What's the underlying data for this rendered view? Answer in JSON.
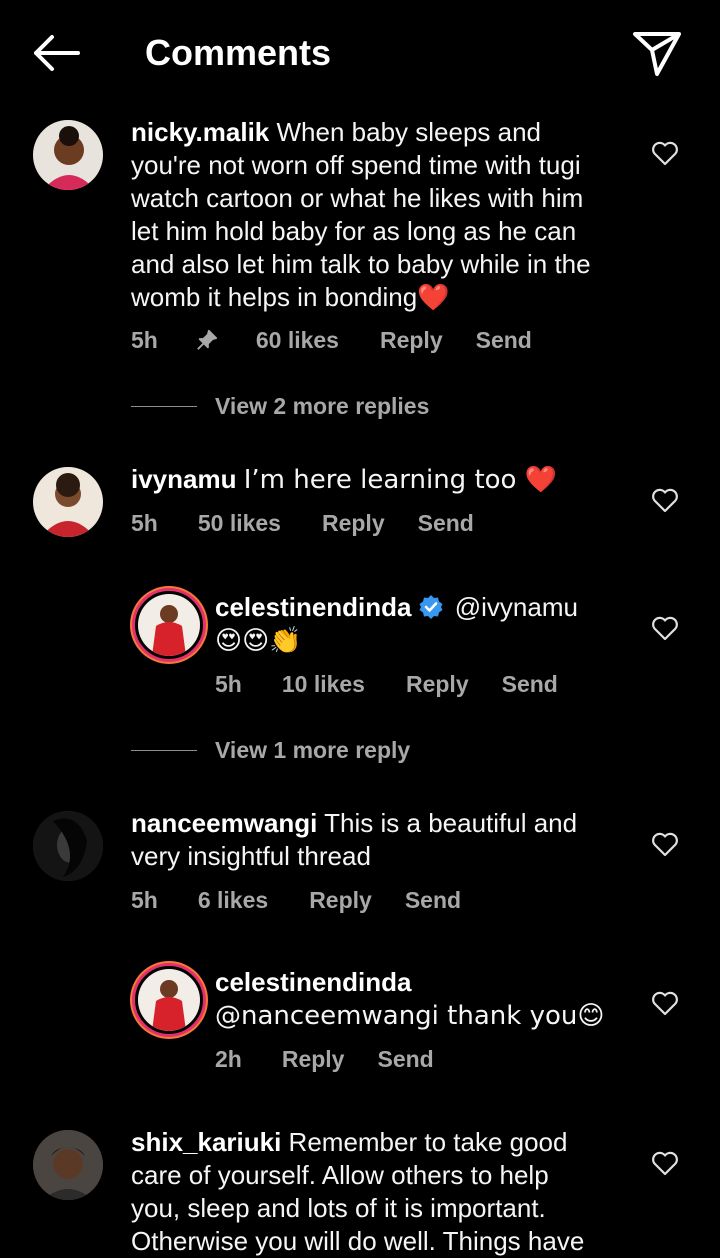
{
  "header": {
    "title": "Comments"
  },
  "comments": [
    {
      "username": "nicky.malik",
      "lines": [
        "When baby sleeps and",
        "you're not worn off spend time with tugi",
        "watch cartoon or what he likes with him",
        "let him hold baby for as long as he can",
        "and also let him talk to baby while in the",
        "womb it helps in bonding❤️"
      ],
      "time": "5h",
      "likes": "60 likes",
      "reply": "Reply",
      "send": "Send",
      "view_replies": "View 2 more replies"
    },
    {
      "username": "ivynamu",
      "lines": [
        "I’m here learning too ❤️"
      ],
      "time": "5h",
      "likes": "50 likes",
      "reply": "Reply",
      "send": "Send"
    },
    {
      "username": "celestinendinda",
      "mention": "@ivynamu",
      "emoji_line": "😍😍👏",
      "time": "5h",
      "likes": "10 likes",
      "reply": "Reply",
      "send": "Send",
      "view_replies": "View 1 more reply"
    },
    {
      "username": "nanceemwangi",
      "lines": [
        "This is a beautiful and",
        "very insightful thread"
      ],
      "time": "5h",
      "likes": "6 likes",
      "reply": "Reply",
      "send": "Send"
    },
    {
      "username": "celestinendinda",
      "lines": [
        "@nanceemwangi thank you😊"
      ],
      "time": "2h",
      "reply": "Reply",
      "send": "Send"
    },
    {
      "username": "shix_kariuki",
      "lines": [
        "Remember to take good",
        "care of yourself. Allow others to help",
        "you, sleep and lots of it is important.",
        "Otherwise you will do well. Things have"
      ]
    }
  ],
  "colors": {
    "background": "#000000",
    "muted": "#a8a8a8",
    "verified": "#3897f0",
    "story_ring": "#e1306c"
  }
}
